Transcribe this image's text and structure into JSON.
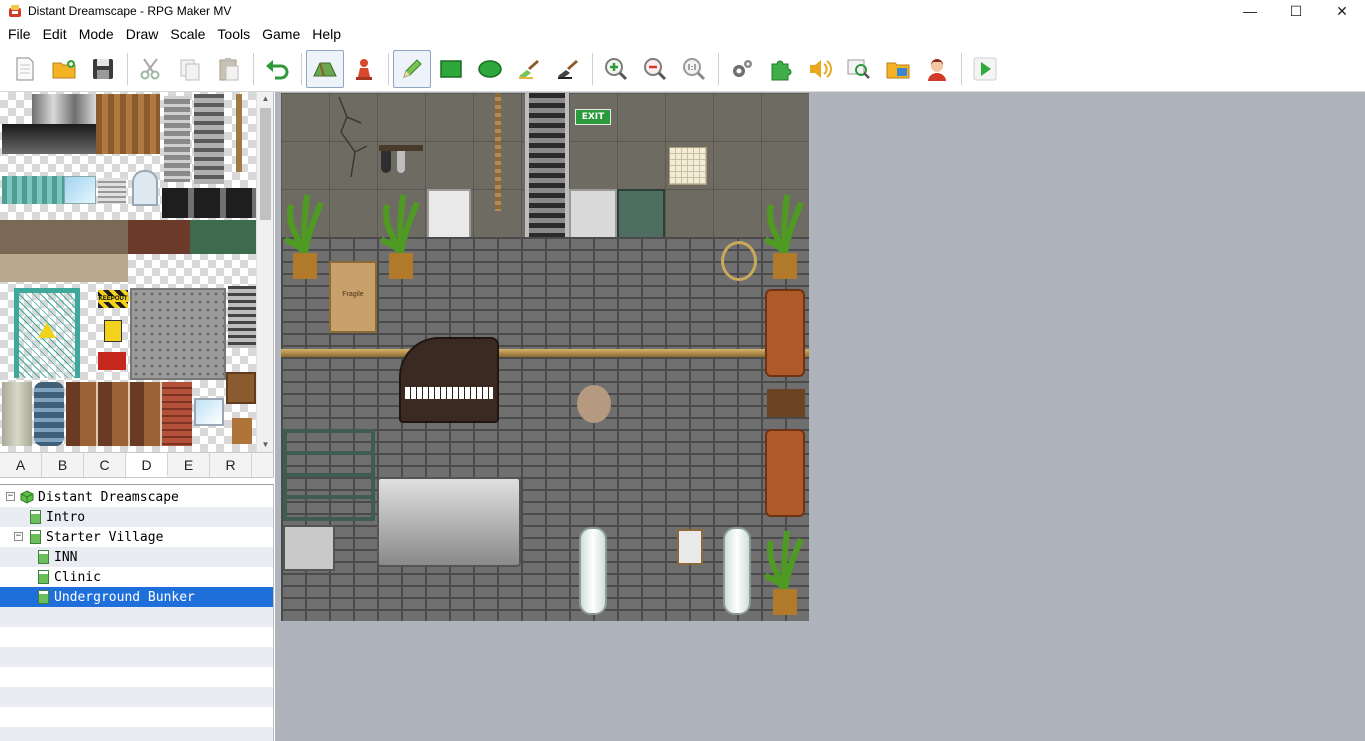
{
  "window": {
    "title": "Distant Dreamscape - RPG Maker MV",
    "controls": {
      "minimize": "—",
      "maximize": "☐",
      "close": "✕"
    }
  },
  "menu": [
    "File",
    "Edit",
    "Mode",
    "Draw",
    "Scale",
    "Tools",
    "Game",
    "Help"
  ],
  "toolbar": {
    "groups": [
      [
        "new-project",
        "open-project",
        "save-project"
      ],
      [
        "cut",
        "copy",
        "paste"
      ],
      [
        "undo"
      ],
      [
        "map-mode",
        "event-mode"
      ],
      [
        "pencil",
        "rectangle",
        "ellipse",
        "fill",
        "shadow-pen"
      ],
      [
        "zoom-in",
        "zoom-out",
        "actual-size"
      ],
      [
        "database",
        "plugin-manager",
        "sound-test",
        "event-searcher",
        "resource-manager",
        "character-generator"
      ],
      [
        "playtest"
      ]
    ],
    "active": [
      "map-mode",
      "pencil"
    ]
  },
  "tileset": {
    "tabs": [
      "A",
      "B",
      "C",
      "D",
      "E",
      "R"
    ],
    "selected_tab": "D",
    "signs": {
      "keepout": "KEEPOUT"
    }
  },
  "map_tree": [
    {
      "label": "Distant Dreamscape",
      "kind": "project",
      "expander": "−",
      "level": 0
    },
    {
      "label": "Intro",
      "kind": "map",
      "level": 1
    },
    {
      "label": "Starter Village",
      "kind": "map",
      "expander": "−",
      "level": 1
    },
    {
      "label": "INN",
      "kind": "map",
      "level": 2
    },
    {
      "label": "Clinic",
      "kind": "map",
      "level": 2
    },
    {
      "label": "Underground Bunker",
      "kind": "map",
      "level": 2,
      "selected": true
    }
  ],
  "map": {
    "exit_sign": "EXIT",
    "box_label": "Fragile"
  },
  "colors": {
    "selection": "#1e6fd9",
    "map_background": "#aeb3bc",
    "alt_row": "#e9edf3"
  }
}
